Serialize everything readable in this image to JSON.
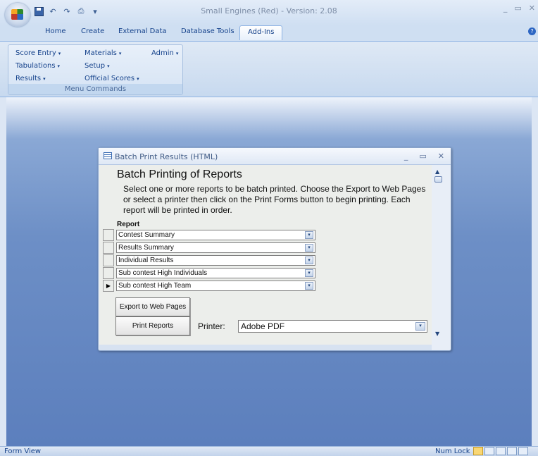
{
  "app": {
    "title": "Small Engines (Red) - Version: 2.08",
    "window_controls": [
      "_",
      "▭",
      "✕"
    ]
  },
  "qat": {
    "save_icon": "save-icon",
    "undo_glyph": "↶",
    "redo_glyph": "↷",
    "print_glyph": "⎙",
    "customize_glyph": "▾"
  },
  "ribbon": {
    "tabs": [
      "Home",
      "Create",
      "External Data",
      "Database Tools",
      "Add-Ins"
    ],
    "active_tab": "Add-Ins",
    "help_glyph": "?",
    "group": {
      "label": "Menu Commands",
      "items": [
        "Score Entry",
        "Materials",
        "Admin",
        "Tabulations",
        "Setup",
        "Results",
        "Official Scores"
      ],
      "dropdown_glyph": "▾"
    }
  },
  "dialog": {
    "title": "Batch Print Results (HTML)",
    "controls": [
      "_",
      "▭",
      "✕"
    ],
    "heading": "Batch Printing of Reports",
    "description": "Select one or more reports to be batch printed.  Choose the Export to Web Pages or select a printer then click on the Print Forms button to begin printing.  Each report will be printed in order.",
    "report_label": "Report",
    "reports": [
      "Contest Summary",
      "Results Summary",
      "Individual Results",
      "Sub contest High Individuals",
      "Sub contest High Team"
    ],
    "current_record_glyph": "▶",
    "combo_glyph": "▾",
    "export_button": "Export to Web Pages",
    "print_button": "Print Reports",
    "printer_label": "Printer:",
    "printer_value": "Adobe PDF",
    "scroll_up_glyph": "▲",
    "scroll_down_glyph": "▼"
  },
  "status": {
    "left": "Form View",
    "numlock": "Num Lock"
  }
}
